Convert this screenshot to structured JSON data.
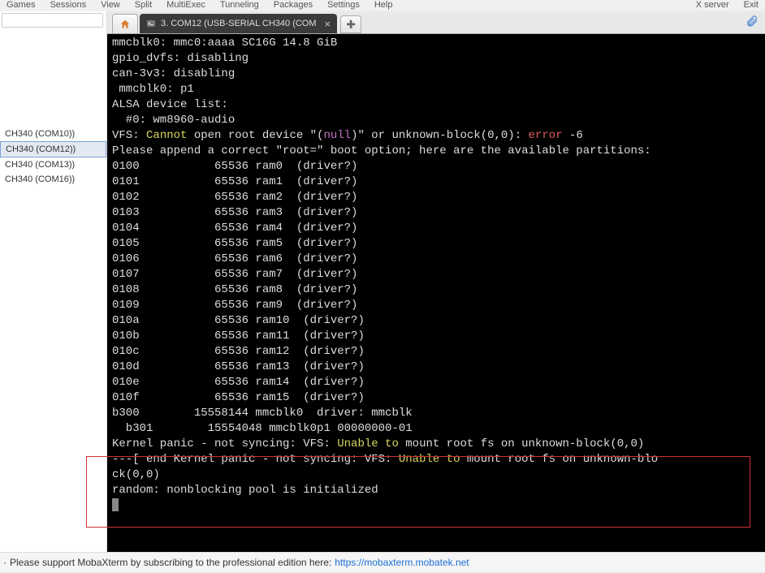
{
  "menubar": [
    "Games",
    "Sessions",
    "View",
    "Split",
    "MultiExec",
    "Tunneling",
    "Packages",
    "Settings",
    "Help",
    "X server",
    "Exit"
  ],
  "sidebar": {
    "ports": [
      {
        "label": "CH340 (COM10))",
        "active": false
      },
      {
        "label": "CH340 (COM12))",
        "active": true
      },
      {
        "label": "CH340 (COM13))",
        "active": false
      },
      {
        "label": "CH340 (COM16))",
        "active": false
      }
    ]
  },
  "tab": {
    "title": "3. COM12  (USB-SERIAL CH340 (COM"
  },
  "terminal": {
    "lines": [
      {
        "t": "mmcblk0: mmc0:aaaa SC16G 14.8 GiB"
      },
      {
        "t": "gpio_dvfs: disabling"
      },
      {
        "t": "can-3v3: disabling"
      },
      {
        "t": " mmcblk0: p1"
      },
      {
        "t": "ALSA device list:"
      },
      {
        "t": "  #0: wm8960-audio"
      },
      {
        "seg": [
          {
            "t": "VFS: "
          },
          {
            "t": "Cannot",
            "c": "t-yellow"
          },
          {
            "t": " open root device \"("
          },
          {
            "t": "null",
            "c": "t-magenta"
          },
          {
            "t": ")\" or unknown-block(0,0): "
          },
          {
            "t": "error",
            "c": "t-red"
          },
          {
            "t": " -6"
          }
        ]
      },
      {
        "t": "Please append a correct \"root=\" boot option; here are the available partitions:"
      },
      {
        "t": "0100           65536 ram0  (driver?)"
      },
      {
        "t": "0101           65536 ram1  (driver?)"
      },
      {
        "t": "0102           65536 ram2  (driver?)"
      },
      {
        "t": "0103           65536 ram3  (driver?)"
      },
      {
        "t": "0104           65536 ram4  (driver?)"
      },
      {
        "t": "0105           65536 ram5  (driver?)"
      },
      {
        "t": "0106           65536 ram6  (driver?)"
      },
      {
        "t": "0107           65536 ram7  (driver?)"
      },
      {
        "t": "0108           65536 ram8  (driver?)"
      },
      {
        "t": "0109           65536 ram9  (driver?)"
      },
      {
        "t": "010a           65536 ram10  (driver?)"
      },
      {
        "t": "010b           65536 ram11  (driver?)"
      },
      {
        "t": "010c           65536 ram12  (driver?)"
      },
      {
        "t": "010d           65536 ram13  (driver?)"
      },
      {
        "t": "010e           65536 ram14  (driver?)"
      },
      {
        "t": "010f           65536 ram15  (driver?)"
      },
      {
        "t": "b300        15558144 mmcblk0  driver: mmcblk"
      },
      {
        "t": "  b301        15554048 mmcblk0p1 00000000-01"
      },
      {
        "seg": [
          {
            "t": "Kernel panic - not syncing: VFS: "
          },
          {
            "t": "Unable to",
            "c": "t-yellow"
          },
          {
            "t": " mount root fs on unknown-block(0,0)"
          }
        ]
      },
      {
        "seg": [
          {
            "t": "---[ end Kernel panic - not syncing: VFS: "
          },
          {
            "t": "Unable to",
            "c": "t-yellow"
          },
          {
            "t": " mount root fs on unknown-blo"
          }
        ]
      },
      {
        "t": "ck(0,0)"
      },
      {
        "t": "random: nonblocking pool is initialized"
      }
    ]
  },
  "footer": {
    "text": "Please support MobaXterm by subscribing to the professional edition here:",
    "link": "https://mobaxterm.mobatek.net"
  }
}
